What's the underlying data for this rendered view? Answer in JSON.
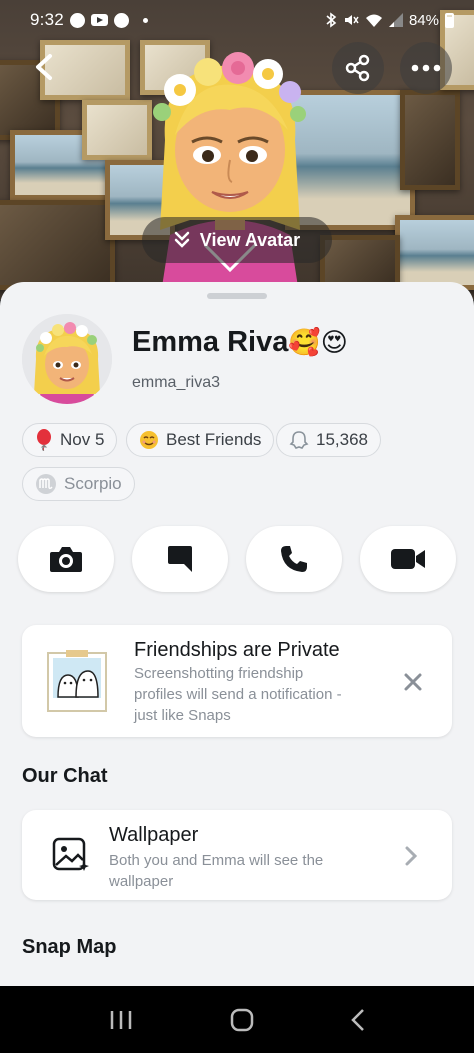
{
  "status_bar": {
    "time": "9:32",
    "battery": "84%",
    "icons": [
      "facebook-icon",
      "youtube-icon",
      "facebook-icon",
      "bluetooth-icon",
      "mute-icon",
      "wifi-icon",
      "signal-icon",
      "battery-icon"
    ]
  },
  "hero": {
    "back_icon": "chevron-left-icon",
    "share_icon": "share-icon",
    "more_icon": "more-icon",
    "view_avatar_label": "View Avatar"
  },
  "profile": {
    "name": "Emma Riva",
    "name_emojis": "🥰😍",
    "username": "emma_riva3"
  },
  "badges": [
    {
      "icon": "balloon-icon",
      "label": "Nov 5"
    },
    {
      "icon": "smile-emoji-icon",
      "label": "Best Friends"
    },
    {
      "icon": "snapscore-ghost-icon",
      "label": "15,368"
    },
    {
      "icon": "scorpio-icon",
      "label": "Scorpio"
    }
  ],
  "actions": [
    {
      "name": "camera-button",
      "icon": "camera-icon"
    },
    {
      "name": "chat-button",
      "icon": "chat-icon"
    },
    {
      "name": "call-button",
      "icon": "phone-icon"
    },
    {
      "name": "video-call-button",
      "icon": "video-icon"
    }
  ],
  "privacy_card": {
    "title": "Friendships are Private",
    "subtitle_lines": [
      "Screenshotting friendship",
      "profiles will send a notification -",
      "just like Snaps"
    ],
    "close_icon": "close-icon"
  },
  "our_chat": {
    "section_title": "Our Chat",
    "wallpaper_title": "Wallpaper",
    "wallpaper_sub_lines": [
      "Both you and Emma will see the",
      "wallpaper"
    ]
  },
  "snap_map": {
    "section_title": "Snap Map"
  },
  "colors": {
    "sheet_bg": "#f2f3f5",
    "card_bg": "#ffffff",
    "text_primary": "#16191c",
    "text_secondary": "#8a9098"
  }
}
